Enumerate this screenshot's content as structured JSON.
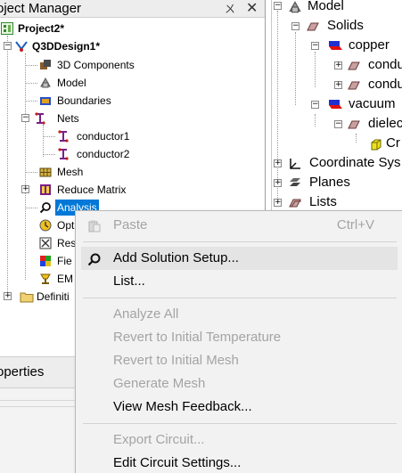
{
  "project_manager": {
    "title": "oject Manager",
    "pin_glyph": "ㄨ",
    "close_glyph": "✕",
    "tree": {
      "project": "Project2*",
      "design": "Q3DDesign1*",
      "items": [
        "3D Components",
        "Model",
        "Boundaries",
        "Nets",
        "conductor1",
        "conductor2",
        "Mesh",
        "Reduce Matrix",
        "Analysis",
        "Opt",
        "Res",
        "Fie",
        "EM",
        "Definiti"
      ]
    }
  },
  "model_tree": {
    "items": [
      "Model",
      "Solids",
      "copper",
      "condu",
      "condu",
      "vacuum",
      "dielec",
      "Cr",
      "Coordinate Sys",
      "Planes",
      "Lists"
    ]
  },
  "properties": {
    "title": "operties"
  },
  "context_menu": {
    "paste": {
      "label": "Paste",
      "shortcut": "Ctrl+V"
    },
    "add_solution_setup": "Add Solution Setup...",
    "list": "List...",
    "analyze_all": "Analyze All",
    "revert_temperature": "Revert to Initial Temperature",
    "revert_mesh": "Revert to Initial Mesh",
    "generate_mesh": "Generate Mesh",
    "view_mesh_feedback": "View Mesh Feedback...",
    "export_circuit": "Export Circuit...",
    "edit_circuit_settings": "Edit Circuit Settings..."
  },
  "colors": {
    "selection": "#0078d7",
    "menu_bg": "#f2f2f2",
    "menu_hover": "#e4e4e4",
    "disabled_text": "#a4a4a4"
  }
}
